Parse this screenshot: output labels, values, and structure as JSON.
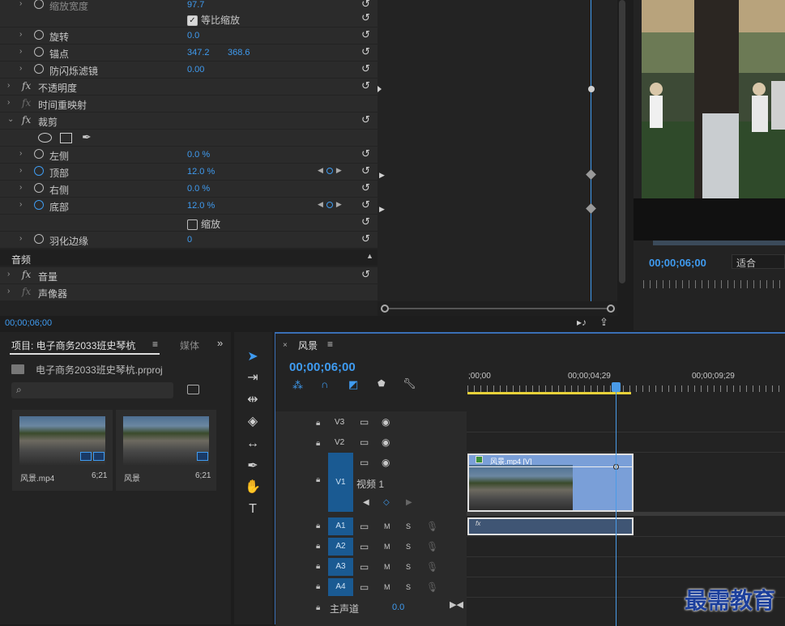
{
  "effects": {
    "rows": [
      {
        "name": "缩放宽度",
        "v1": "97.7",
        "dim": true
      },
      {
        "checkbox": "等比缩放",
        "checked": true
      },
      {
        "name": "旋转",
        "v1": "0.0"
      },
      {
        "name": "锚点",
        "v1": "347.2",
        "v2": "368.6"
      },
      {
        "name": "防闪烁滤镜",
        "v1": "0.00"
      },
      {
        "fx": "不透明度"
      },
      {
        "fx": "时间重映射",
        "dimfx": true
      },
      {
        "fx": "裁剪",
        "open": true
      },
      {
        "name": "左侧",
        "v1": "0.0 %"
      },
      {
        "name": "顶部",
        "v1": "12.0 %",
        "keyed": true
      },
      {
        "name": "右侧",
        "v1": "0.0 %"
      },
      {
        "name": "底部",
        "v1": "12.0 %",
        "keyed": true
      },
      {
        "checkbox": "缩放",
        "checked": false
      },
      {
        "name": "羽化边缘",
        "v1": "0"
      }
    ],
    "audio_header": "音频",
    "audio_rows": [
      "音量",
      "声像器"
    ],
    "footer_time": "00;00;06;00"
  },
  "monitor": {
    "timecode": "00;00;06;00",
    "fit": "适合"
  },
  "project": {
    "tab_label": "项目: 电子商务2033班史琴杭",
    "tab2_label": "媒体",
    "file_name": "电子商务2033班史琴杭.prproj",
    "items": [
      {
        "name": "风景.mp4",
        "duration": "6;21"
      },
      {
        "name": "风景",
        "duration": "6;21"
      }
    ]
  },
  "timeline": {
    "tab": "风景",
    "timecode": "00;00;06;00",
    "ruler": [
      ";00;00",
      "00;00;04;29",
      "00;00;09;29"
    ],
    "video_tracks": [
      "V3",
      "V2",
      "V1"
    ],
    "v1_name": "视频 1",
    "audio_tracks": [
      "A1",
      "A2",
      "A3",
      "A4"
    ],
    "master_label": "主声道",
    "master_value": "0.0",
    "clip_label": "风景.mp4 [V]",
    "audio_clip_label": "fx"
  },
  "watermark": "最需教育",
  "colors": {
    "accent": "#3f9bf0",
    "target": "#1a5a92",
    "clip": "#7a9fd8",
    "playhead": "#4a9be8"
  }
}
